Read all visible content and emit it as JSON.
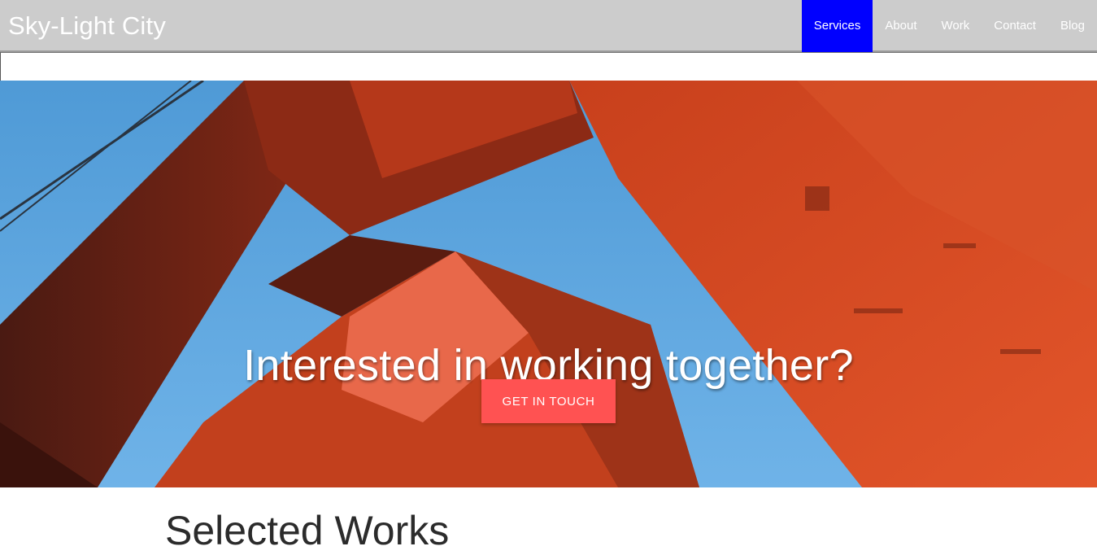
{
  "navbar": {
    "brand": "Sky-Light City",
    "links": [
      {
        "label": "Services",
        "active": true
      },
      {
        "label": "About",
        "active": false
      },
      {
        "label": "Work",
        "active": false
      },
      {
        "label": "Contact",
        "active": false
      },
      {
        "label": "Blog",
        "active": false
      }
    ],
    "active_color": "#0000ff",
    "background": "#cccccc"
  },
  "hero": {
    "title": "Interested in working together?",
    "cta_label": "GET IN TOUCH",
    "cta_color": "#ff5252",
    "image_subject": "bridge-tower-photo"
  },
  "works": {
    "title": "Selected Works"
  }
}
